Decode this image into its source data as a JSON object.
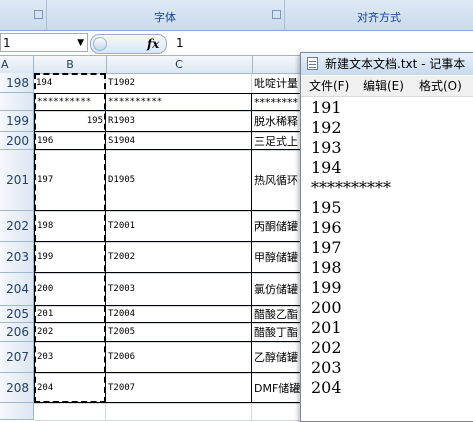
{
  "ribbon": {
    "groups": [
      {
        "label": ""
      },
      {
        "label": "字体"
      },
      {
        "label": "对齐方式"
      }
    ]
  },
  "formula_bar": {
    "name_box": "1",
    "fx_label": "fx",
    "value": "1"
  },
  "columns": [
    "A",
    "B",
    "C",
    ""
  ],
  "rows": [
    {
      "num": "198",
      "b": "194",
      "c": "T1902",
      "d": "吡啶计量"
    },
    {
      "num": "",
      "b": "**********",
      "c": "**********",
      "d": "********"
    },
    {
      "num": "199",
      "b": "195",
      "c": "R1903",
      "d": "脱水稀释"
    },
    {
      "num": "200",
      "b": "196",
      "c": "S1904",
      "d": "三足式上"
    },
    {
      "num": "201",
      "b": "197",
      "c": "D1905",
      "d": "热风循环"
    },
    {
      "num": "202",
      "b": "198",
      "c": "T2001",
      "d": "丙酮储罐"
    },
    {
      "num": "203",
      "b": "199",
      "c": "T2002",
      "d": "甲醇储罐"
    },
    {
      "num": "204",
      "b": "200",
      "c": "T2003",
      "d": "氯仿储罐"
    },
    {
      "num": "205",
      "b": "201",
      "c": "T2004",
      "d": "醋酸乙酯"
    },
    {
      "num": "206",
      "b": "202",
      "c": "T2005",
      "d": "醋酸丁酯"
    },
    {
      "num": "207",
      "b": "203",
      "c": "T2006",
      "d": "乙醇储罐"
    },
    {
      "num": "208",
      "b": "204",
      "c": "T2007",
      "d": "DMF储罐"
    },
    {
      "num": "",
      "b": "",
      "c": "",
      "d": ""
    }
  ],
  "notepad": {
    "title": "新建文本文档.txt - 记事本",
    "menu": [
      "文件(F)",
      "编辑(E)",
      "格式(O)"
    ],
    "lines": [
      "191",
      "192",
      "193",
      "194",
      "**********",
      "195",
      "196",
      "197",
      "198",
      "199",
      "200",
      "201",
      "202",
      "203",
      "204"
    ]
  }
}
